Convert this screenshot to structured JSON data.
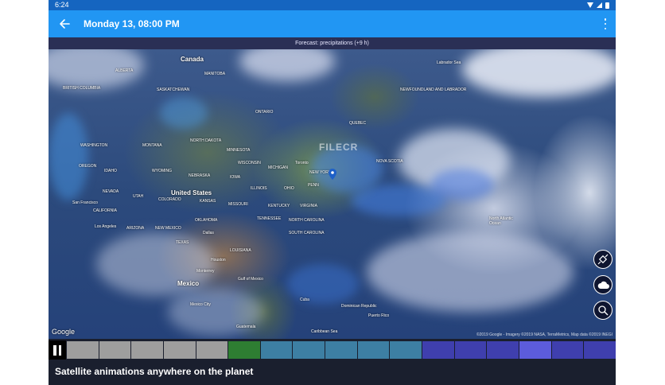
{
  "status_bar": {
    "time": "6:24"
  },
  "app_bar": {
    "title": "Monday 13, 08:00 PM"
  },
  "forecast": {
    "label": "Forecast: precipitations (+9 h)"
  },
  "map": {
    "watermark": "FILECR",
    "labels": [
      {
        "name": "Canada",
        "big": true
      },
      {
        "name": "United States",
        "big": true
      },
      {
        "name": "Mexico",
        "big": true
      },
      {
        "name": "Labrador Sea"
      },
      {
        "name": "NEWFOUNDLAND AND LABRADOR"
      },
      {
        "name": "QUEBEC"
      },
      {
        "name": "ONTARIO"
      },
      {
        "name": "MANITOBA"
      },
      {
        "name": "ALBERTA"
      },
      {
        "name": "BRITISH COLUMBIA"
      },
      {
        "name": "SASKATCHEWAN"
      },
      {
        "name": "WASHINGTON"
      },
      {
        "name": "MONTANA"
      },
      {
        "name": "NORTH DAKOTA"
      },
      {
        "name": "MINNESOTA"
      },
      {
        "name": "WISCONSIN"
      },
      {
        "name": "MICHIGAN"
      },
      {
        "name": "Toronto"
      },
      {
        "name": "NEW YORK"
      },
      {
        "name": "NOVA SCOTIA"
      },
      {
        "name": "OREGON"
      },
      {
        "name": "IDAHO"
      },
      {
        "name": "WYOMING"
      },
      {
        "name": "NEBRASKA"
      },
      {
        "name": "IOWA"
      },
      {
        "name": "ILLINOIS"
      },
      {
        "name": "OHIO"
      },
      {
        "name": "PENN"
      },
      {
        "name": "NEVADA"
      },
      {
        "name": "UTAH"
      },
      {
        "name": "COLORADO"
      },
      {
        "name": "KANSAS"
      },
      {
        "name": "MISSOURI"
      },
      {
        "name": "KENTUCKY"
      },
      {
        "name": "VIRGINIA"
      },
      {
        "name": "San Francisco"
      },
      {
        "name": "CALIFORNIA"
      },
      {
        "name": "Los Angeles"
      },
      {
        "name": "ARIZONA"
      },
      {
        "name": "NEW MEXICO"
      },
      {
        "name": "OKLAHOMA"
      },
      {
        "name": "TENNESSEE"
      },
      {
        "name": "NORTH CAROLINA"
      },
      {
        "name": "SOUTH CAROLINA"
      },
      {
        "name": "TEXAS"
      },
      {
        "name": "Dallas"
      },
      {
        "name": "LOUISIANA"
      },
      {
        "name": "Houston"
      },
      {
        "name": "Gulf of Mexico"
      },
      {
        "name": "Monterrey"
      },
      {
        "name": "Cuba"
      },
      {
        "name": "Mexico City"
      },
      {
        "name": "Guatemala"
      },
      {
        "name": "Dominican Republic"
      },
      {
        "name": "Puerto Rico"
      },
      {
        "name": "Caribbean Sea"
      },
      {
        "name": "North Atlantic Ocean"
      }
    ],
    "google_logo": "Google",
    "attribution": "©2019 Google - Imagery ©2019 NASA, TerraMetrics, Map data ©2019 INEGI"
  },
  "map_buttons": [
    {
      "icon": "satellite-icon"
    },
    {
      "icon": "cloud-icon"
    },
    {
      "icon": "zoom-icon"
    }
  ],
  "timeline": {
    "state": "playing",
    "slots": [
      {
        "color": "#9e9e9e"
      },
      {
        "color": "#9e9e9e"
      },
      {
        "color": "#9e9e9e"
      },
      {
        "color": "#9e9e9e"
      },
      {
        "color": "#9e9e9e"
      },
      {
        "color": "#2e7d32"
      },
      {
        "color": "#3d7fa3"
      },
      {
        "color": "#3d7fa3"
      },
      {
        "color": "#3d7fa3"
      },
      {
        "color": "#3d7fa3"
      },
      {
        "color": "#3d7fa3"
      },
      {
        "color": "#3f3fae"
      },
      {
        "color": "#3f3fae"
      },
      {
        "color": "#3f3fae"
      },
      {
        "color": "#5c5cdc"
      },
      {
        "color": "#3f3fae"
      },
      {
        "color": "#3f3fae"
      }
    ]
  },
  "caption": "Satellite animations anywhere on the planet"
}
